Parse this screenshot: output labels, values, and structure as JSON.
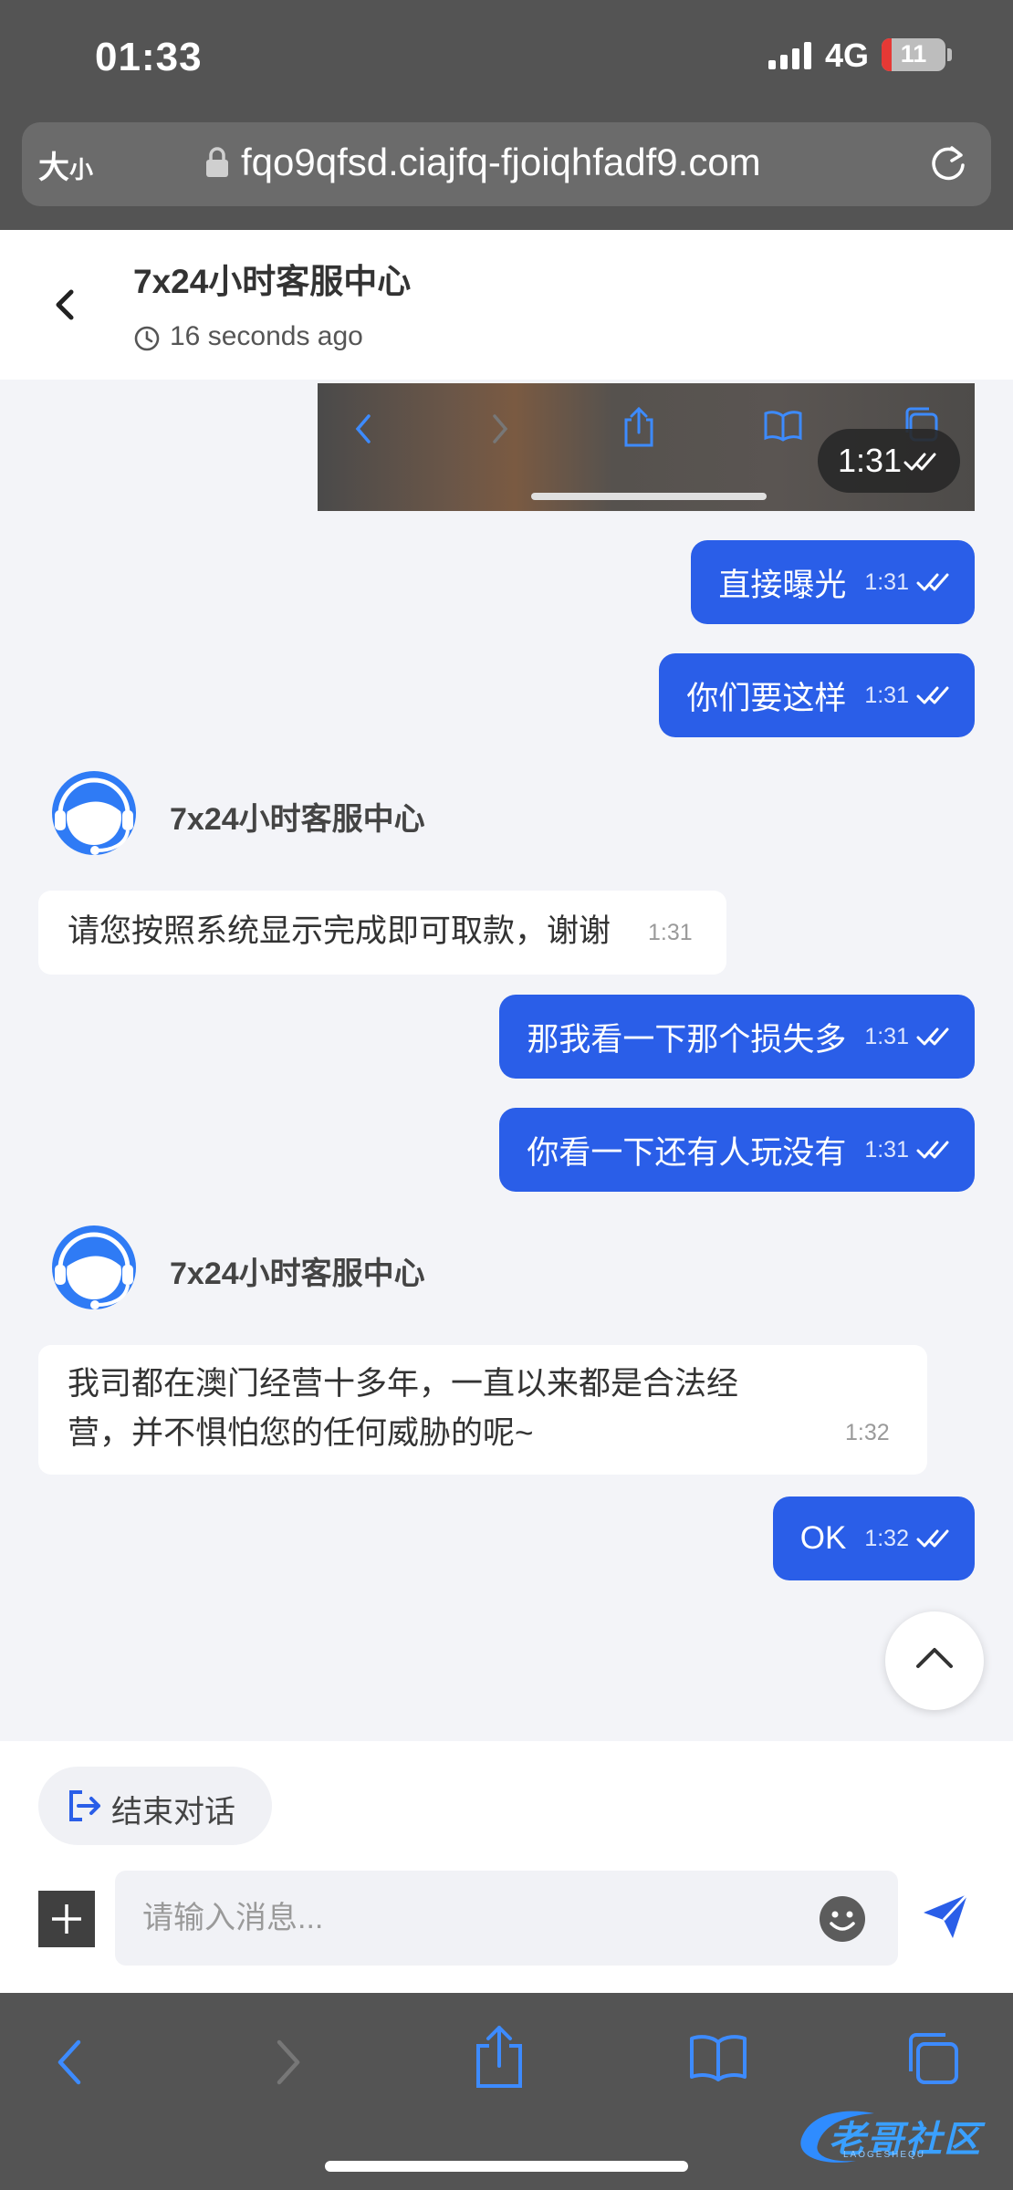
{
  "status_bar": {
    "time": "01:33",
    "network": "4G",
    "battery": "11",
    "battery_level": 0.11
  },
  "browser": {
    "text_size_big": "大",
    "text_size_small": "小",
    "url": "fqo9qfsd.ciajfq-fjoiqhfadf9.com",
    "icons": {
      "lock": "lock-icon",
      "reload": "reload-icon"
    }
  },
  "header": {
    "title": "7x24小时客服中心",
    "last_seen": "16 seconds ago"
  },
  "messages": {
    "image_time": "1:31",
    "m1": {
      "text": "直接曝光",
      "time": "1:31"
    },
    "m2": {
      "text": "你们要这样",
      "time": "1:31"
    },
    "agent1": {
      "name": "7x24小时客服中心"
    },
    "m3": {
      "text": "请您按照系统显示完成即可取款，谢谢",
      "time": "1:31"
    },
    "m4": {
      "text": "那我看一下那个损失多",
      "time": "1:31"
    },
    "m5": {
      "text": "你看一下还有人玩没有",
      "time": "1:31"
    },
    "agent2": {
      "name": "7x24小时客服中心"
    },
    "m6": {
      "line1": "我司都在澳门经营十多年，一直以来都是合法经",
      "line2": "营，并不惧怕您的任何威胁的呢~",
      "time": "1:32"
    },
    "m7": {
      "text": "OK",
      "time": "1:32"
    }
  },
  "footer": {
    "end_chat": "结束对话",
    "input_placeholder": "请输入消息..."
  },
  "watermark": {
    "text": "老哥社区",
    "sub": "LAOGESHEQU"
  },
  "colors": {
    "accent": "#2a5ee8",
    "chrome": "#545454",
    "safari_blue": "#3d8bff"
  }
}
